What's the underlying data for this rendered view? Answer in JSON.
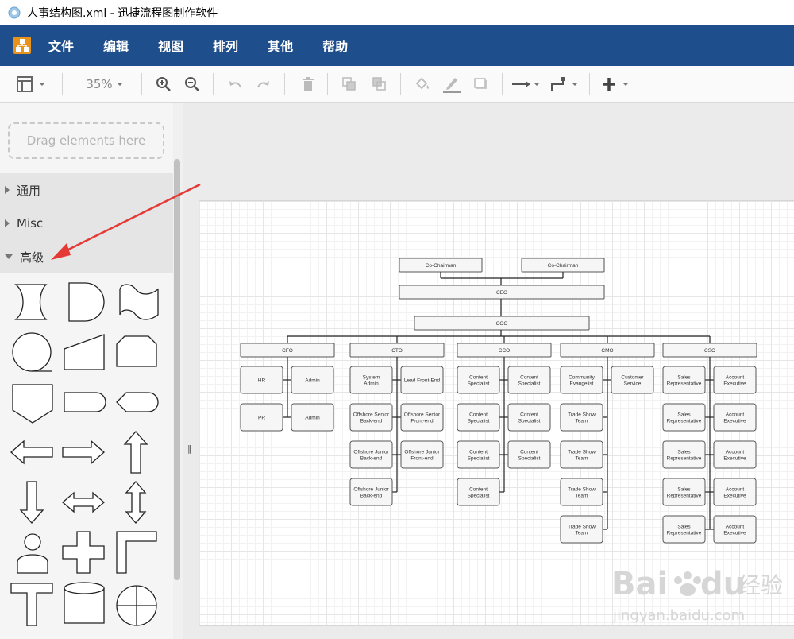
{
  "window": {
    "title": "人事结构图.xml - 迅捷流程图制作软件"
  },
  "menu": [
    "文件",
    "编辑",
    "视图",
    "排列",
    "其他",
    "帮助"
  ],
  "toolbar": {
    "zoom": "35%",
    "icons": [
      "format-panel-icon",
      "dropdown-icon",
      "zoom-in-icon",
      "zoom-out-icon",
      "undo-icon",
      "redo-icon",
      "delete-icon",
      "to-front-icon",
      "to-back-icon",
      "fill-color-icon",
      "line-color-icon",
      "shadow-icon",
      "connection-icon",
      "waypoints-icon",
      "insert-icon"
    ]
  },
  "sidebar": {
    "drag_hint": "Drag elements here",
    "sections": [
      {
        "label": "通用",
        "expanded": false
      },
      {
        "label": "Misc",
        "expanded": false
      },
      {
        "label": "高级",
        "expanded": true
      }
    ],
    "shapes": [
      "stored-data-shape",
      "delay-shape",
      "tape-shape",
      "sequential-data-shape",
      "manual-input-shape",
      "card-shape",
      "off-page-connector-shape",
      "terminator-shape",
      "display-shape",
      "left-arrow-shape",
      "right-arrow-shape",
      "up-arrow-shape",
      "down-arrow-shape",
      "left-right-arrow-shape",
      "up-down-arrow-shape",
      "actor-shape",
      "cross-shape",
      "corner-shape",
      "t-shape",
      "cylinder-shape",
      "summing-junction-shape"
    ]
  },
  "org_chart": {
    "top": [
      "Co-Chairman",
      "Co-Chairman"
    ],
    "ceo": "CEO",
    "coo": "COO",
    "departments": [
      {
        "name": "CFO",
        "left": [
          [
            "HR"
          ],
          [
            "PR"
          ]
        ],
        "right": [
          [
            "Admin"
          ],
          [
            "Admin"
          ]
        ]
      },
      {
        "name": "CTO",
        "left": [
          [
            "System",
            "Admin"
          ],
          [
            "Offshore Senior",
            "Back-end"
          ],
          [
            "Offshore Junior",
            "Back-end"
          ],
          [
            "Offshore Junior",
            "Back-end"
          ]
        ],
        "right": [
          [
            "Lead Front-End"
          ],
          [
            "Offshore Senior",
            "Front-end"
          ],
          [
            "Offshore Junior",
            "Front-end"
          ]
        ]
      },
      {
        "name": "CCO",
        "left": [
          [
            "Content",
            "Specialist"
          ],
          [
            "Content",
            "Specialist"
          ],
          [
            "Content",
            "Specialist"
          ],
          [
            "Content",
            "Specialist"
          ]
        ],
        "right": [
          [
            "Content",
            "Specialist"
          ],
          [
            "Content",
            "Specialist"
          ],
          [
            "Content",
            "Specialist"
          ]
        ]
      },
      {
        "name": "CMO",
        "left": [
          [
            "Community",
            "Evangelist"
          ],
          [
            "Trade Show",
            "Team"
          ],
          [
            "Trade Show",
            "Team"
          ],
          [
            "Trade Show",
            "Team"
          ],
          [
            "Trade Show",
            "Team"
          ]
        ],
        "right": [
          [
            "Customer",
            "Service"
          ]
        ]
      },
      {
        "name": "CSO",
        "left": [
          [
            "Sales",
            "Representative"
          ],
          [
            "Sales",
            "Representative"
          ],
          [
            "Sales",
            "Representative"
          ],
          [
            "Sales",
            "Representative"
          ],
          [
            "Sales",
            "Representative"
          ]
        ],
        "right": [
          [
            "Account",
            "Executive"
          ],
          [
            "Account",
            "Executive"
          ],
          [
            "Account",
            "Executive"
          ],
          [
            "Account",
            "Executive"
          ],
          [
            "Account",
            "Executive"
          ]
        ]
      }
    ]
  },
  "watermark": {
    "brand": "Bai",
    "brand_suffix": "du",
    "cn": "经验",
    "url": "jingyan.baidu.com"
  },
  "colors": {
    "menubar": "#1f4e8c",
    "annotation_arrow": "#e53935"
  }
}
